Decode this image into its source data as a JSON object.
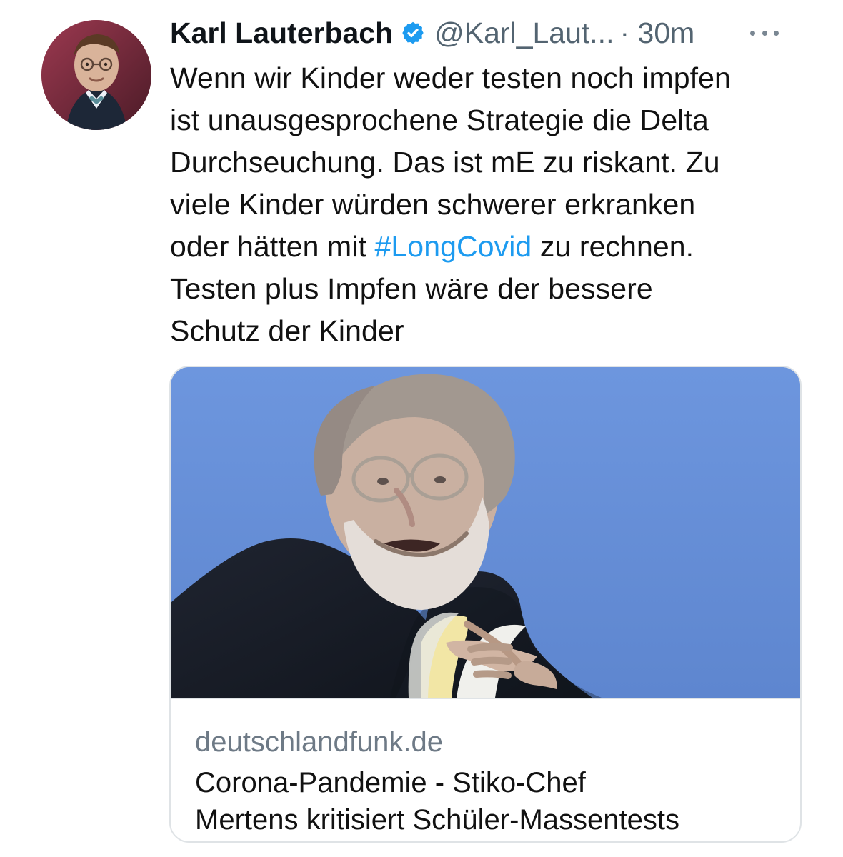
{
  "tweet": {
    "author": {
      "name": "Karl Lauterbach",
      "handle": "@Karl_Laut...",
      "verified_icon": "verified-badge-icon",
      "avatar_icon": "avatar-image"
    },
    "time": "· 30m",
    "menu_icon": "more-options-icon",
    "text": {
      "line1": "Wenn wir Kinder weder testen noch impfen",
      "line2": "ist unausgesprochene Strategie die Delta",
      "line3": "Durchseuchung. Das ist mE zu riskant. Zu",
      "line4": "viele Kinder würden schwerer erkranken",
      "line5_before": "oder hätten mit ",
      "line5_hashtag": "#LongCovid",
      "line5_after": " zu rechnen.",
      "line6": "Testen plus Impfen wäre der bessere",
      "line7": "Schutz der Kinder"
    },
    "link_card": {
      "image": "article-photo",
      "domain": "deutschlandfunk.de",
      "title_line1": "Corona-Pandemie - Stiko-Chef",
      "title_line2": "Mertens kritisiert Schüler-Massentests"
    }
  },
  "colors": {
    "text": "#111111",
    "muted": "#536471",
    "link": "#1d9bf0",
    "verified": "#1d9bf0",
    "card_border": "#dfe3e6",
    "card_bg": "#6f97de"
  }
}
